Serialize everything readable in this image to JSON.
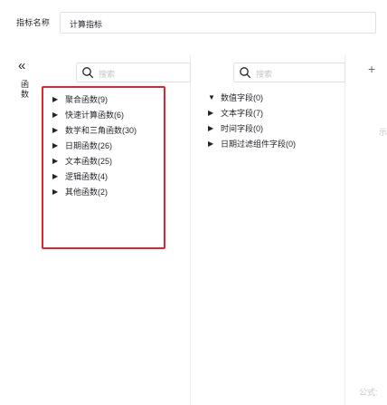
{
  "name_bar": {
    "label": "指标名称",
    "value": "计算指标"
  },
  "rail": {
    "collapse_icon": "«",
    "label": "函数"
  },
  "functions": {
    "search_placeholder": "搜索",
    "items": [
      {
        "label": "聚合函数(9)",
        "caret": "▶"
      },
      {
        "label": "快速计算函数(6)",
        "caret": "▶"
      },
      {
        "label": "数学和三角函数(30)",
        "caret": "▶"
      },
      {
        "label": "日期函数(26)",
        "caret": "▶"
      },
      {
        "label": "文本函数(25)",
        "caret": "▶"
      },
      {
        "label": "逻辑函数(4)",
        "caret": "▶"
      },
      {
        "label": "其他函数(2)",
        "caret": "▶"
      }
    ]
  },
  "fields": {
    "search_placeholder": "搜索",
    "items": [
      {
        "label": "数值字段(0)",
        "caret": "▼"
      },
      {
        "label": "文本字段(7)",
        "caret": "▶"
      },
      {
        "label": "时间字段(0)",
        "caret": "▶"
      },
      {
        "label": "日期过滤组件字段(0)",
        "caret": "▶"
      }
    ]
  },
  "editor": {
    "add_icon": "+",
    "example_placeholder": "示例:",
    "formula_placeholder": "公式:"
  },
  "colors": {
    "highlight_border": "#e0242f",
    "border": "#dee0e3",
    "placeholder": "#c2c6cc",
    "text": "#1f2329"
  }
}
